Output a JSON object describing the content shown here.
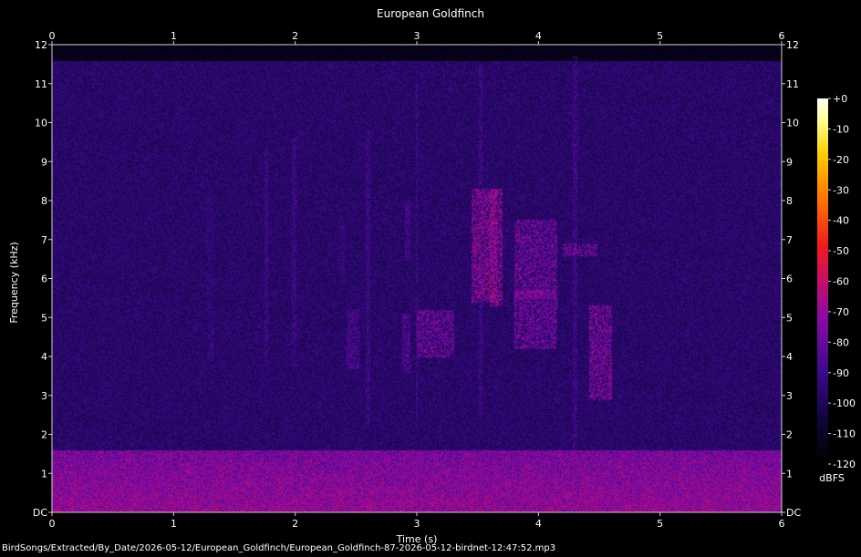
{
  "chart_data": {
    "type": "heatmap",
    "title": "European Goldfinch",
    "xlabel": "Time (s)",
    "ylabel": "Frequency (kHz)",
    "xlim": [
      0,
      6
    ],
    "ylim": [
      0,
      12
    ],
    "x_ticks": [
      "0",
      "1",
      "2",
      "3",
      "4",
      "5",
      "6"
    ],
    "y_ticks": [
      "DC",
      "1",
      "2",
      "3",
      "4",
      "5",
      "6",
      "7",
      "8",
      "9",
      "10",
      "11",
      "12"
    ],
    "colorbar": {
      "label": "dBFS",
      "range": [
        -120,
        0
      ],
      "ticks": [
        "+0",
        "-10",
        "-20",
        "-30",
        "-40",
        "-50",
        "-60",
        "-70",
        "-80",
        "-90",
        "-100",
        "-110",
        "-120"
      ]
    },
    "noise_floor_khz": [
      0,
      1.6
    ],
    "signal_ceiling_khz": 11.6,
    "features": [
      {
        "t": [
          0.23,
          0.25
        ],
        "f": [
          3.6,
          4.1
        ],
        "level": 0.25
      },
      {
        "t": [
          1.27,
          1.32
        ],
        "f": [
          4.8,
          8.2
        ],
        "level": 0.45
      },
      {
        "t": [
          1.28,
          1.33
        ],
        "f": [
          3.9,
          4.7
        ],
        "level": 0.5
      },
      {
        "t": [
          1.75,
          1.77
        ],
        "f": [
          3.8,
          9.3
        ],
        "level": 0.55
      },
      {
        "t": [
          1.97,
          2.0
        ],
        "f": [
          3.8,
          9.6
        ],
        "level": 0.55
      },
      {
        "t": [
          2.36,
          2.4
        ],
        "f": [
          5.9,
          7.6
        ],
        "level": 0.5
      },
      {
        "t": [
          2.42,
          2.52
        ],
        "f": [
          3.7,
          5.2
        ],
        "level": 0.6
      },
      {
        "t": [
          2.58,
          2.61
        ],
        "f": [
          2.3,
          9.8
        ],
        "level": 0.55
      },
      {
        "t": [
          2.88,
          2.94
        ],
        "f": [
          3.6,
          5.1
        ],
        "level": 0.65
      },
      {
        "t": [
          2.9,
          2.94
        ],
        "f": [
          6.5,
          8.0
        ],
        "level": 0.6
      },
      {
        "t": [
          2.99,
          3.0
        ],
        "f": [
          2.2,
          11.0
        ],
        "level": 0.55
      },
      {
        "t": [
          3.0,
          3.3
        ],
        "f": [
          4.0,
          5.2
        ],
        "level": 0.75
      },
      {
        "t": [
          3.45,
          3.65
        ],
        "f": [
          5.4,
          8.3
        ],
        "level": 0.85
      },
      {
        "t": [
          3.51,
          3.53
        ],
        "f": [
          2.5,
          11.5
        ],
        "level": 0.55
      },
      {
        "t": [
          3.6,
          3.7
        ],
        "f": [
          5.3,
          8.3
        ],
        "level": 0.85
      },
      {
        "t": [
          3.8,
          4.15
        ],
        "f": [
          4.2,
          7.5
        ],
        "level": 0.75
      },
      {
        "t": [
          3.8,
          4.15
        ],
        "f": [
          5.5,
          5.7
        ],
        "level": 0.8
      },
      {
        "t": [
          4.28,
          4.31
        ],
        "f": [
          1.6,
          11.7
        ],
        "level": 0.55
      },
      {
        "t": [
          4.2,
          4.48
        ],
        "f": [
          6.6,
          6.9
        ],
        "level": 0.75
      },
      {
        "t": [
          4.42,
          4.6
        ],
        "f": [
          2.9,
          5.3
        ],
        "level": 0.8
      }
    ]
  },
  "footer_path": "BirdSongs/Extracted/By_Date/2026-05-12/European_Goldfinch/European_Goldfinch-87-2026-05-12-birdnet-12:47:52.mp3",
  "colors": {
    "background": "#000000",
    "axis": "#d0d0d0",
    "text": "#ffffff"
  }
}
